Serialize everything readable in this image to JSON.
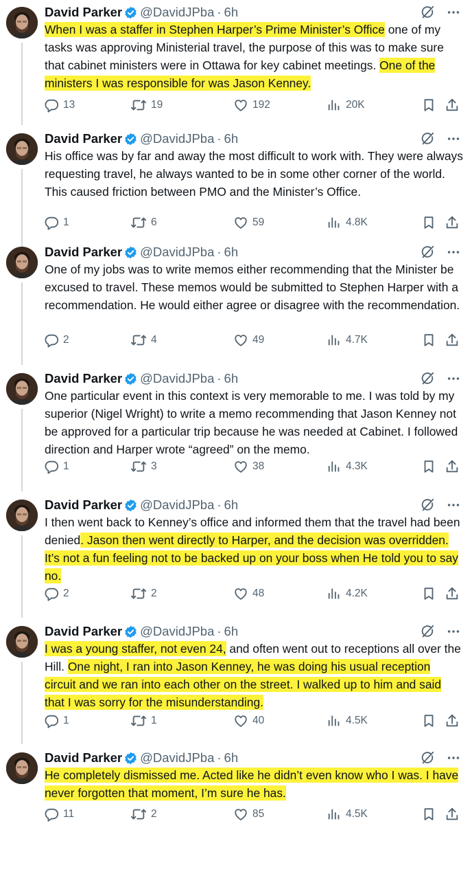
{
  "author": {
    "name": "David Parker",
    "handle": "@DavidJPba",
    "dot": "·",
    "time": "6h"
  },
  "tweets": [
    {
      "segments": [
        {
          "text": "When I was a staffer in Stephen Harper’s Prime Minister’s Office",
          "hl": true
        },
        {
          "text": " one of my tasks was approving Ministerial travel, the purpose of this was to make sure that cabinet ministers were in Ottawa for key cabinet meetings. ",
          "hl": false
        },
        {
          "text": "One of the ministers I was responsible for was Jason Kenney.",
          "hl": true
        }
      ],
      "replies": "13",
      "reposts": "19",
      "likes": "192",
      "views": "20K"
    },
    {
      "segments": [
        {
          "text": "His office was by far and away the most difficult to work with. They were always requesting travel, he always wanted to be in some other corner of the world. This caused friction between PMO and the Minister’s Office.",
          "hl": false
        }
      ],
      "replies": "1",
      "reposts": "6",
      "likes": "59",
      "views": "4.8K"
    },
    {
      "segments": [
        {
          "text": "One of my jobs was to write memos either recommending that the Minister be excused to travel. These memos would be submitted to Stephen Harper with a recommendation. He would either agree or disagree with the recommendation.",
          "hl": false
        }
      ],
      "replies": "2",
      "reposts": "4",
      "likes": "49",
      "views": "4.7K"
    },
    {
      "segments": [
        {
          "text": "One particular event in this context is very memorable to me. I was told by my superior (Nigel Wright) to write a memo recommending that Jason Kenney not be approved for a particular trip because he was needed at Cabinet. I followed direction and Harper wrote “agreed” on the memo.",
          "hl": false
        }
      ],
      "replies": "1",
      "reposts": "3",
      "likes": "38",
      "views": "4.3K"
    },
    {
      "segments": [
        {
          "text": "I then went back to Kenney’s office and informed them that the travel had been denied",
          "hl": false
        },
        {
          "text": ". Jason then went directly to Harper, and the decision was overridden. It’s not a fun feeling not to be backed up on your boss when He told you to say no.",
          "hl": true
        }
      ],
      "replies": "2",
      "reposts": "2",
      "likes": "48",
      "views": "4.2K"
    },
    {
      "segments": [
        {
          "text": "I was a young staffer, not even 24,",
          "hl": true
        },
        {
          "text": " and often went out to receptions all over the Hill. ",
          "hl": false
        },
        {
          "text": "One night, I ran into Jason Kenney, he was doing his usual reception circuit and we ran into each other on the street. I walked up to him and said that I was sorry for the misunderstanding.",
          "hl": true
        }
      ],
      "replies": "1",
      "reposts": "1",
      "likes": "40",
      "views": "4.5K"
    },
    {
      "segments": [
        {
          "text": "He completely dismissed me. Acted like he didn’t even know who I was. I have never forgotten that moment, I’m sure he has.",
          "hl": true
        }
      ],
      "replies": "11",
      "reposts": "2",
      "likes": "85",
      "views": "4.5K"
    }
  ],
  "colors": {
    "highlight": "#fdf23a",
    "verified": "#1d9bf0",
    "muted": "#536471"
  },
  "icons": [
    "verified-badge-icon",
    "grok-icon",
    "more-icon",
    "reply-icon",
    "repost-icon",
    "like-icon",
    "views-icon",
    "bookmark-icon",
    "share-icon"
  ]
}
